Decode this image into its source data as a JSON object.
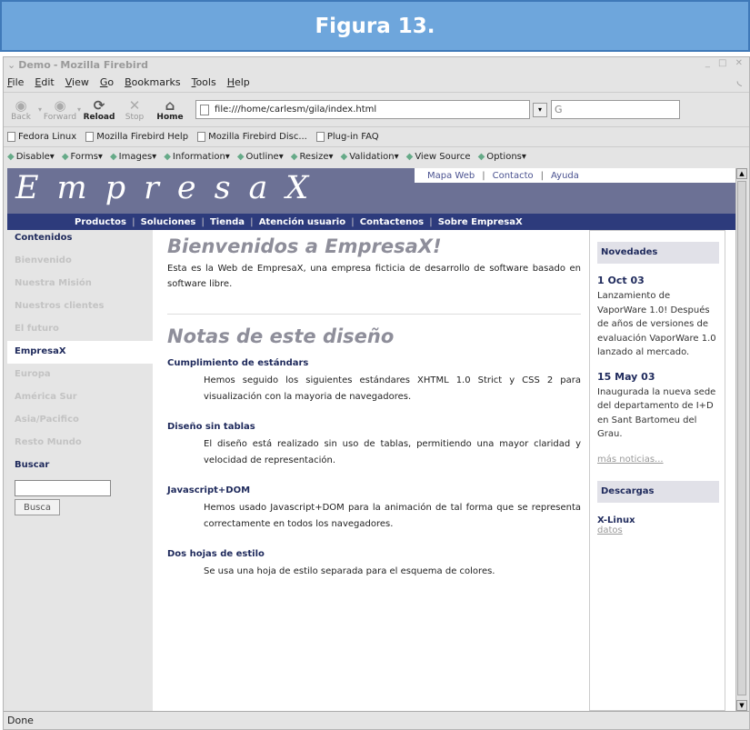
{
  "figure": {
    "caption": "Figura 13."
  },
  "window": {
    "title_app": "Demo",
    "title_browser": "Mozilla Firebird"
  },
  "menubar": [
    {
      "label": "File",
      "key": "F",
      "rest": "ile"
    },
    {
      "label": "Edit",
      "key": "E",
      "rest": "dit"
    },
    {
      "label": "View",
      "key": "V",
      "rest": "iew"
    },
    {
      "label": "Go",
      "key": "G",
      "rest": "o"
    },
    {
      "label": "Bookmarks",
      "key": "B",
      "rest": "ookmarks"
    },
    {
      "label": "Tools",
      "key": "T",
      "rest": "ools"
    },
    {
      "label": "Help",
      "key": "H",
      "rest": "elp"
    }
  ],
  "nav": {
    "back": "Back",
    "forward": "Forward",
    "reload": "Reload",
    "stop": "Stop",
    "home": "Home",
    "url": "file:///home/carlesm/gila/index.html",
    "search_value": "G"
  },
  "bookmarks": [
    "Fedora Linux",
    "Mozilla Firebird Help",
    "Mozilla Firebird Disc...",
    "Plug-in FAQ"
  ],
  "devbar": [
    "Disable▾",
    "Forms▾",
    "Images▾",
    "Information▾",
    "Outline▾",
    "Resize▾",
    "Validation▾",
    "View Source",
    "Options▾"
  ],
  "status": "Done",
  "page": {
    "logo": "EmpresaX",
    "toplinks": [
      "Mapa Web",
      "Contacto",
      "Ayuda"
    ],
    "mainnav": [
      "Productos",
      "Soluciones",
      "Tienda",
      "Atención usuario",
      "Contactenos",
      "Sobre EmpresaX"
    ],
    "sidebar": {
      "heading1": "Contenidos",
      "items1": [
        "Bienvenido",
        "Nuestra Misión",
        "Nuestros clientes",
        "El futuro"
      ],
      "active": "EmpresaX",
      "items2": [
        "Europa",
        "América Sur",
        "Asia/Pacifico",
        "Resto Mundo"
      ],
      "heading2": "Buscar",
      "search_button": "Busca"
    },
    "main": {
      "title": "Bienvenidos a EmpresaX!",
      "intro": "Esta es la Web de EmpresaX, una empresa ficticia de desarrollo de software basado en software libre.",
      "notes_title": "Notas de este diseño",
      "notes": [
        {
          "heading": "Cumplimiento de estándars",
          "text": "Hemos seguido los siguientes estándares XHTML 1.0 Strict y CSS 2 para visualización con la mayoria de navegadores."
        },
        {
          "heading": "Diseño sin tablas",
          "text": "El diseño está realizado sin uso de tablas, permitiendo una mayor claridad y velocidad de representación."
        },
        {
          "heading": "Javascript+DOM",
          "text": "Hemos usado Javascript+DOM para la animación de tal forma que se representa correctamente en todos los navegadores."
        },
        {
          "heading": "Dos hojas de estilo",
          "text": "Se usa una hoja de estilo separada para el esquema de colores."
        }
      ]
    },
    "right": {
      "news_heading": "Novedades",
      "news": [
        {
          "date": "1 Oct 03",
          "text": "Lanzamiento de VaporWare 1.0! Después de años de versiones de evaluación VaporWare 1.0 lanzado al mercado."
        },
        {
          "date": "15 May 03",
          "text": "Inaugurada la nueva sede del departamento de I+D en Sant Bartomeu del Grau."
        }
      ],
      "more_news": "más noticias...",
      "downloads_heading": "Descargas",
      "download_item": "X-Linux",
      "download_link": "datos"
    }
  }
}
